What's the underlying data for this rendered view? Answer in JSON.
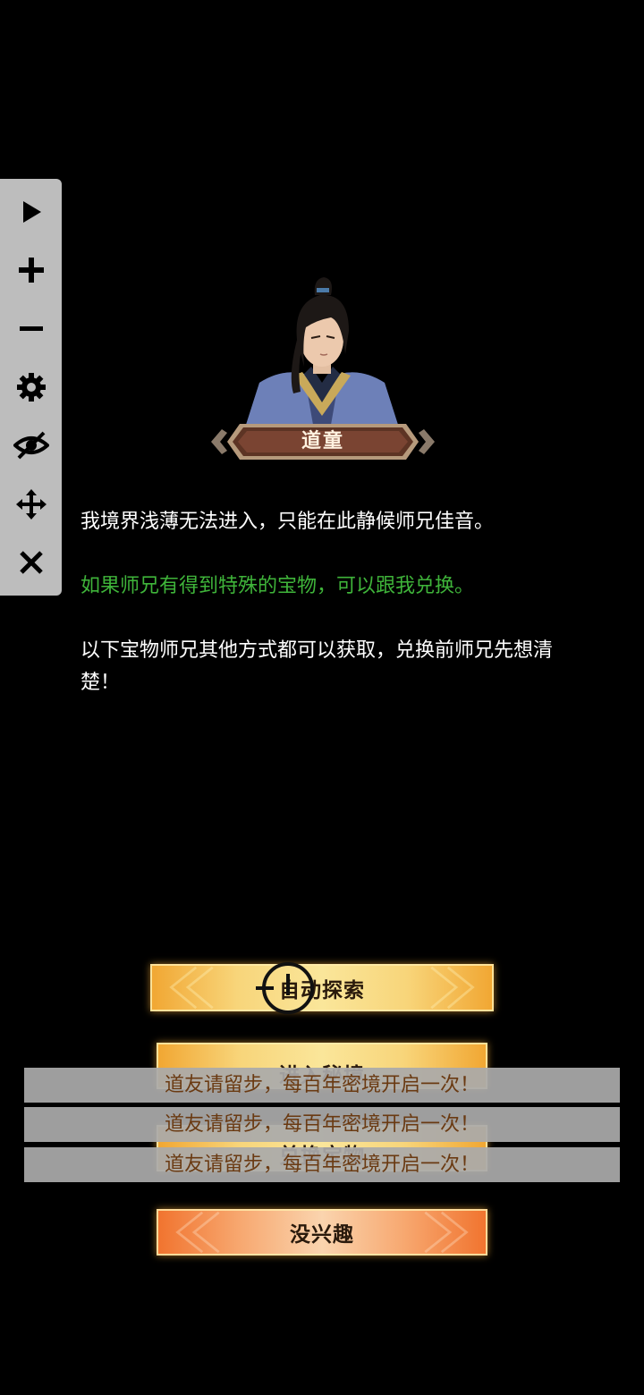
{
  "toolbar": {
    "items": [
      {
        "icon": "play-icon"
      },
      {
        "icon": "plus-icon"
      },
      {
        "icon": "minus-icon"
      },
      {
        "icon": "gear-icon"
      },
      {
        "icon": "eye-off-icon"
      },
      {
        "icon": "move-icon"
      },
      {
        "icon": "close-icon"
      }
    ]
  },
  "npc": {
    "name": "道童"
  },
  "dialog": {
    "line1": "我境界浅薄无法进入，只能在此静候师兄佳音。",
    "line2": "如果师兄有得到特殊的宝物，可以跟我兑换。",
    "line3": "以下宝物师兄其他方式都可以获取，兑换前师兄先想清楚！"
  },
  "buttons": {
    "auto_explore": "自动探索",
    "enter_realm": "进入秘境",
    "exchange": "兑换宝物",
    "not_interested": "没兴趣"
  },
  "toasts": [
    "道友请留步，每百年密境开启一次！",
    "道友请留步，每百年密境开启一次！",
    "道友请留步，每百年密境开启一次！"
  ],
  "colors": {
    "background": "#000000",
    "toolbar": "#bdbdbd",
    "dialog_highlight": "#3fb43a",
    "button_gold": "#f8d57a",
    "button_orange": "#f7a870",
    "toast_text": "#6a3a12"
  }
}
